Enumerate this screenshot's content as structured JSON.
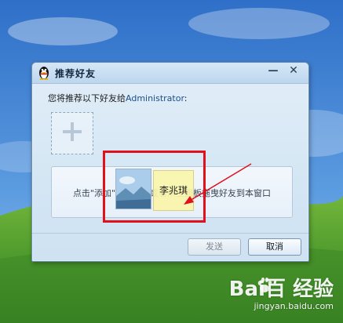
{
  "dialog": {
    "title": "推荐好友",
    "minimize_glyph": "—",
    "close_glyph": "✕",
    "prompt_prefix": "您将推荐以下好友给",
    "prompt_recipient": "Administrator",
    "prompt_suffix": ":",
    "add_slot_icon": "plus-icon",
    "drop_hint": "点击\"添加\"选择好友或者从主面板拖曳好友到本窗口",
    "send_label": "发送",
    "cancel_label": "取消"
  },
  "dragged_contact": {
    "name": "李兆琪",
    "avatar_icon": "landscape-avatar-icon"
  },
  "annotation": {
    "highlight_color": "#e0101c",
    "arrow_color": "#e0101c"
  },
  "watermark": {
    "brand": "Bai百 经验",
    "url": "jingyan.baidu.com"
  },
  "colors": {
    "desktop_sky": "#3f86d6",
    "desktop_grass": "#4f9b2e",
    "dialog_bg": "#d4e6f4",
    "link_text": "#1a4f8f"
  }
}
